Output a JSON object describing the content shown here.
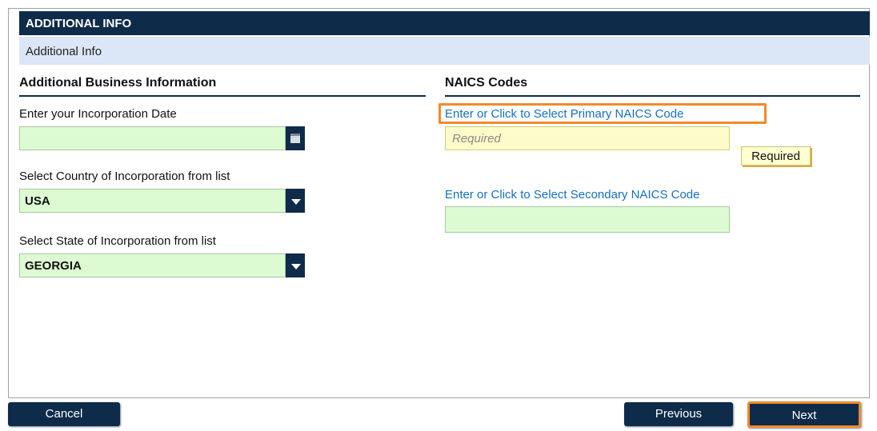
{
  "header": {
    "title": "ADDITIONAL INFO"
  },
  "subheader": {
    "label": "Additional Info"
  },
  "left": {
    "section_title": "Additional Business Information",
    "incorporation_date": {
      "label": "Enter your Incorporation Date",
      "value": ""
    },
    "country": {
      "label": "Select Country of Incorporation from list",
      "value": "USA"
    },
    "state": {
      "label": "Select State of Incorporation from list",
      "value": "GEORGIA"
    }
  },
  "right": {
    "section_title": "NAICS Codes",
    "primary": {
      "link": "Enter or Click to Select Primary NAICS Code",
      "placeholder": "Required",
      "tooltip": "Required"
    },
    "secondary": {
      "link": "Enter or Click to Select Secondary NAICS Code",
      "value": ""
    }
  },
  "footer": {
    "cancel": "Cancel",
    "previous": "Previous",
    "next": "Next"
  },
  "colors": {
    "navy": "#0e2b4a",
    "field_green": "#ddfbd2",
    "field_yellow": "#fdfbc9",
    "link_blue": "#1570c2",
    "highlight_orange": "#f28a2a"
  },
  "icons": {
    "date_picker": "calendar-icon",
    "dropdown": "chevron-down-icon"
  }
}
